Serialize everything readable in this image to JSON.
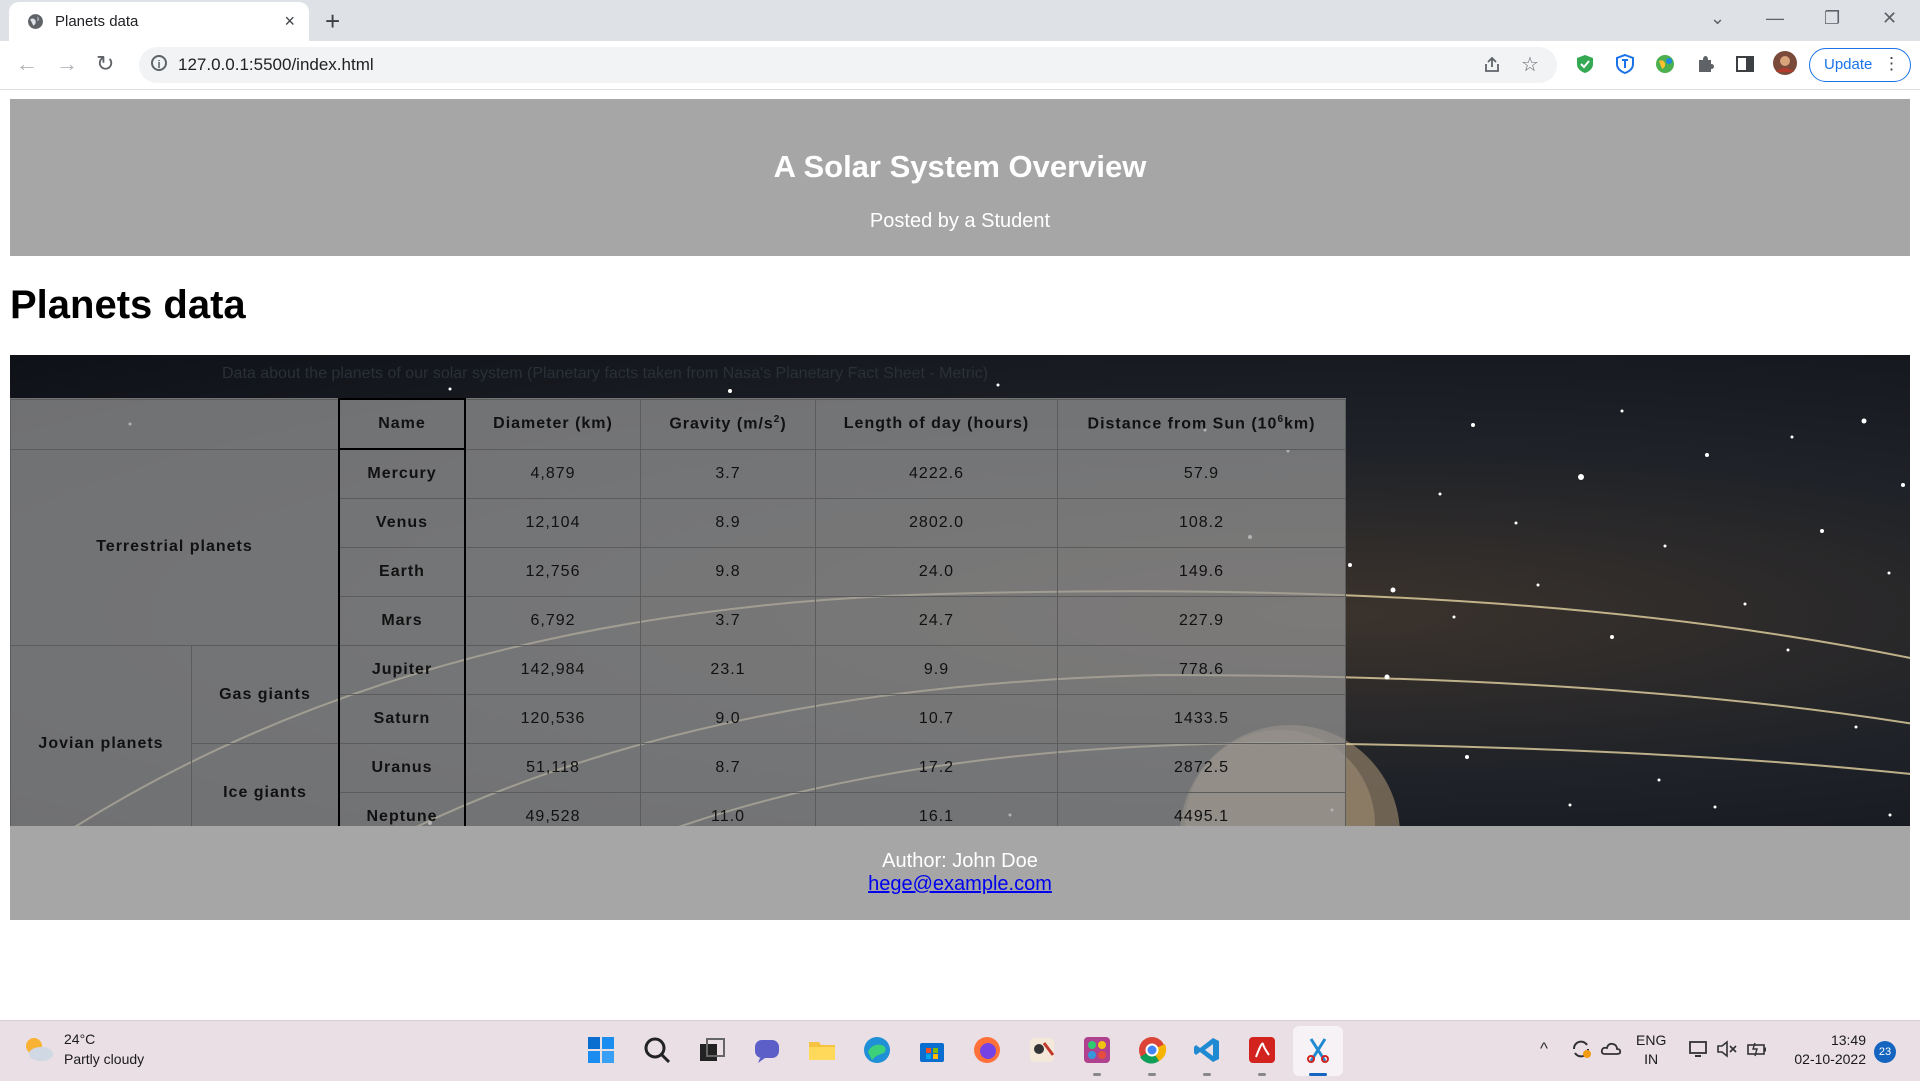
{
  "browser": {
    "tab_title": "Planets data",
    "tab_close": "×",
    "new_tab": "+",
    "url": "127.0.0.1:5500/index.html",
    "update_label": "Update",
    "menu_dots": "⋮",
    "window_controls": {
      "chevron": "⌄",
      "minimize": "—",
      "restore": "❐",
      "close": "✕"
    },
    "nav": {
      "back": "←",
      "forward": "→",
      "reload": "↻"
    }
  },
  "header": {
    "title": "A Solar System Overview",
    "subtitle": "Posted by a Student"
  },
  "page_title": "Planets data",
  "table": {
    "caption": "Data about the planets of our solar system (Planetary facts taken from Nasa's Planetary Fact Sheet - Metric)",
    "headers": {
      "name": "Name",
      "diameter": "Diameter (km)",
      "gravity": "Gravity (m/s",
      "gravity_sup": "2",
      "gravity_end": ")",
      "day": "Length of day (hours)",
      "distance": "Distance from Sun (10",
      "distance_sup": "6",
      "distance_end": "km)"
    },
    "groups": {
      "terrestrial": "Terrestrial planets",
      "jovian": "Jovian planets",
      "gas": "Gas giants",
      "ice": "Ice giants"
    },
    "rows": [
      {
        "name": "Mercury",
        "diameter": "4,879",
        "gravity": "3.7",
        "day": "4222.6",
        "distance": "57.9"
      },
      {
        "name": "Venus",
        "diameter": "12,104",
        "gravity": "8.9",
        "day": "2802.0",
        "distance": "108.2"
      },
      {
        "name": "Earth",
        "diameter": "12,756",
        "gravity": "9.8",
        "day": "24.0",
        "distance": "149.6"
      },
      {
        "name": "Mars",
        "diameter": "6,792",
        "gravity": "3.7",
        "day": "24.7",
        "distance": "227.9"
      },
      {
        "name": "Jupiter",
        "diameter": "142,984",
        "gravity": "23.1",
        "day": "9.9",
        "distance": "778.6"
      },
      {
        "name": "Saturn",
        "diameter": "120,536",
        "gravity": "9.0",
        "day": "10.7",
        "distance": "1433.5"
      },
      {
        "name": "Uranus",
        "diameter": "51,118",
        "gravity": "8.7",
        "day": "17.2",
        "distance": "2872.5"
      },
      {
        "name": "Neptune",
        "diameter": "49,528",
        "gravity": "11.0",
        "day": "16.1",
        "distance": "4495.1"
      }
    ]
  },
  "footer": {
    "author": "Author: John Doe",
    "email": "hege@example.com"
  },
  "taskbar": {
    "temperature": "24°C",
    "weather": "Partly cloudy",
    "language": "ENG",
    "region": "IN",
    "time": "13:49",
    "date": "02-10-2022",
    "notifications": "23"
  },
  "colors": {
    "header_bg": "#a6a6a6",
    "link": "#0000ee",
    "accent": "#1a73e8"
  }
}
